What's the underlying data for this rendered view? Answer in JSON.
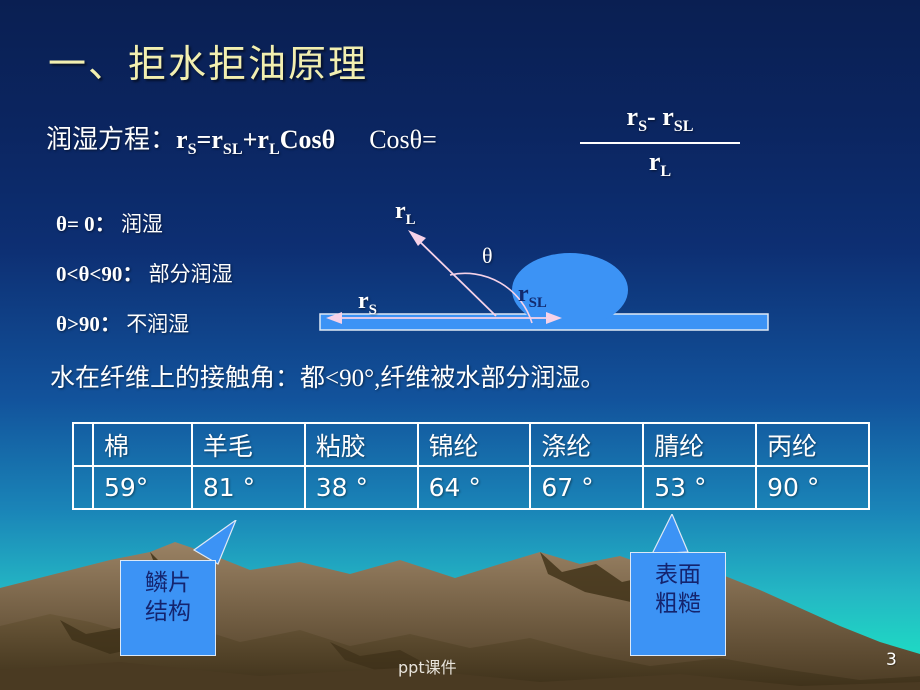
{
  "slide": {
    "title": "一、拒水拒油原理",
    "page_number": "3",
    "footer_watermark": "ppt课件",
    "title_color": "#f2efb0",
    "background_top_color": "#0a1f52",
    "background_bottom_color": "#19ddc6"
  },
  "equation": {
    "label": "润湿方程：",
    "main": "r",
    "main_sub": "S",
    "eq": "=r",
    "eq_sub": "SL",
    "plus": "+r",
    "plus_sub": "L",
    "cos": "Cosθ",
    "cos_theta_label": "Cosθ=",
    "fraction": {
      "numerator_a": "r",
      "numerator_a_sub": "S",
      "numerator_minus": "- r",
      "numerator_b_sub": "SL",
      "denominator": "r",
      "denominator_sub": "L"
    }
  },
  "conditions": [
    {
      "expr": "θ= 0：",
      "result": "润湿"
    },
    {
      "expr": "0<θ<90：",
      "result": "部分润湿"
    },
    {
      "expr": "θ>90：",
      "result": "不润湿"
    }
  ],
  "diagram": {
    "label_rl": "r",
    "label_rl_sub": "L",
    "label_theta": "θ",
    "label_rs": "r",
    "label_rs_sub": "S",
    "label_rsl": "r",
    "label_rsl_sub": "SL",
    "droplet_color": "#3c93f5",
    "substrate_color": "#3c93f5",
    "arrow_color": "#f6d2e8"
  },
  "contact_angle_note": "水在纤维上的接触角：都<90°,纤维被水部分润湿。",
  "table": {
    "headers": [
      "棉",
      "羊毛",
      "粘胶",
      "锦纶",
      "涤纶",
      "腈纶",
      "丙纶"
    ],
    "values": [
      "59°",
      "81 °",
      "38 °",
      "64 °",
      "67 °",
      "53 °",
      "90 °"
    ]
  },
  "callouts": [
    {
      "line1": "鳞片",
      "line2": "结构"
    },
    {
      "line1": "表面",
      "line2": "粗糙"
    }
  ],
  "chart_data": {
    "type": "table",
    "title": "水在纤维上的接触角",
    "categories": [
      "棉",
      "羊毛",
      "粘胶",
      "锦纶",
      "涤纶",
      "腈纶",
      "丙纶"
    ],
    "values": [
      59,
      81,
      38,
      64,
      67,
      53,
      90
    ],
    "ylabel": "接触角 (°)",
    "note": "都<90°,纤维被水部分润湿。"
  }
}
